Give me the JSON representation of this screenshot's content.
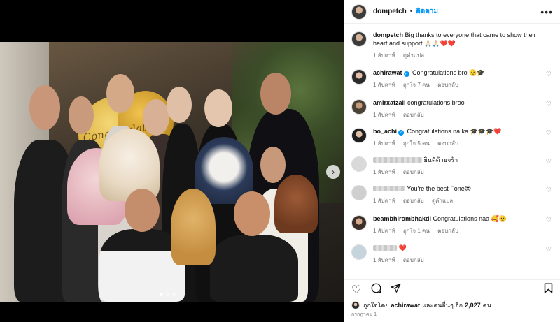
{
  "post": {
    "username": "dompetch",
    "follow_label": "ติดตาม",
    "separator": "•",
    "more_icon": "more-icon"
  },
  "photo": {
    "balloon_text": "Congratulations",
    "slide_count": 3,
    "active_slide": 1
  },
  "caption": {
    "username": "dompetch",
    "text": "Big thanks to everyone that came to show their heart and support 🙏🏻🙏🏻❤️❤️",
    "time": "1 สัปดาห์",
    "translate": "ดูคำแปล"
  },
  "comments": [
    {
      "username": "achirawat",
      "verified": true,
      "text": "Congratulations bro 🫡🎓",
      "time": "1 สัปดาห์",
      "likes": "ถูกใจ 7 คน",
      "reply": "ตอบกลับ",
      "extra": ""
    },
    {
      "username": "amirxafzali",
      "verified": false,
      "text": "congratulations broo",
      "time": "1 สัปดาห์",
      "likes": "",
      "reply": "ตอบกลับ",
      "extra": ""
    },
    {
      "username": "bo_achi",
      "verified": true,
      "text": "Congratulations na ka 🎓🎓🎓❤️",
      "time": "1 สัปดาห์",
      "likes": "ถูกใจ 5 คน",
      "reply": "ตอบกลับ",
      "extra": ""
    },
    {
      "username": "",
      "verified": false,
      "text": "ยินดีด้วยจร้า",
      "time": "1 สัปดาห์",
      "likes": "",
      "reply": "ตอบกลับ",
      "extra": ""
    },
    {
      "username": "",
      "verified": false,
      "text": "You're the best Fone😍",
      "time": "1 สัปดาห์",
      "likes": "",
      "reply": "ตอบกลับ",
      "extra": "ดูคำแปล"
    },
    {
      "username": "beambhirombhakdi",
      "verified": false,
      "text": "Congratulations naa 🥰🫡",
      "time": "1 สัปดาห์",
      "likes": "ถูกใจ 1 คน",
      "reply": "ตอบกลับ",
      "extra": ""
    },
    {
      "username": "",
      "verified": false,
      "text": "❤️",
      "time": "1 สัปดาห์",
      "likes": "",
      "reply": "ตอบกลับ",
      "extra": ""
    }
  ],
  "actions": {
    "like_icon": "heart-icon",
    "comment_icon": "comment-icon",
    "share_icon": "share-icon",
    "save_icon": "bookmark-icon"
  },
  "likes_line": {
    "prefix": "ถูกใจโดย",
    "user": "achirawat",
    "middle": "และคนอื่นๆ อีก",
    "count": "2,027",
    "suffix": "คน"
  },
  "date": "กรกฎาคม 1",
  "colors": {
    "accent": "#0095f6",
    "heart_red": "#ed4956",
    "meta_gray": "#737373"
  }
}
